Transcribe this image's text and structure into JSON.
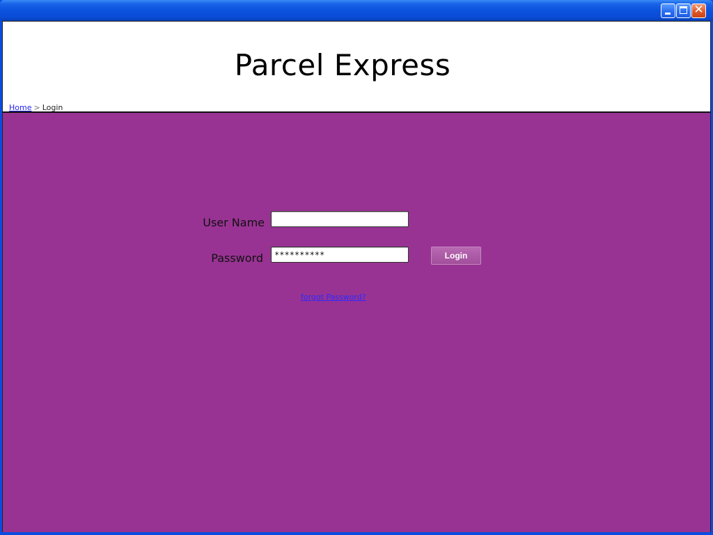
{
  "window": {
    "minimize_label": "_",
    "maximize_label": "□",
    "close_label": "✕"
  },
  "header": {
    "title": "Parcel Express",
    "breadcrumb": {
      "home": "Home",
      "separator": ">",
      "current": "Login"
    }
  },
  "login_form": {
    "username_label": "User Name",
    "username_value": "",
    "password_label": "Password",
    "password_value": "**********",
    "login_button": "Login",
    "forgot_link": "forgot Password?"
  },
  "colors": {
    "titlebar": "#0a4de0",
    "main_background": "#983393",
    "login_button": "#a24e9c",
    "link": "#2a2aff"
  }
}
